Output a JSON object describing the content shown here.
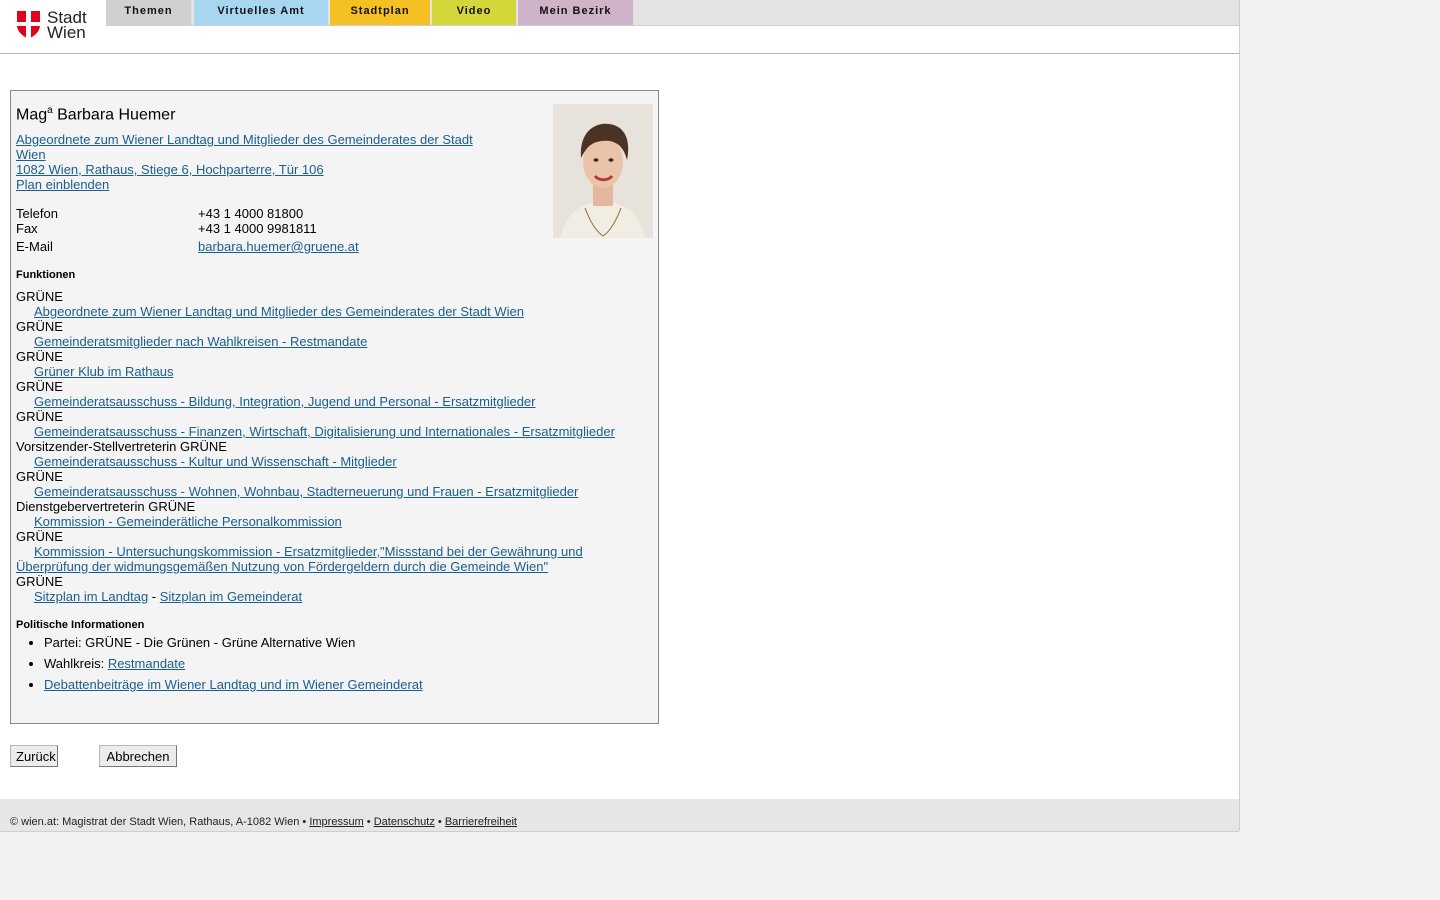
{
  "header": {
    "logo_text_line1": "Stadt",
    "logo_text_line2": "Wien",
    "tabs": [
      {
        "label": "Themen",
        "color": "#d0d0d0"
      },
      {
        "label": "Virtuelles Amt",
        "color": "#a8d5f0"
      },
      {
        "label": "Stadtplan",
        "color": "#f5c022"
      },
      {
        "label": "Video",
        "color": "#d4d73a"
      },
      {
        "label": "Mein Bezirk",
        "color": "#cfb3c8"
      }
    ]
  },
  "person": {
    "title_prefix": "Mag",
    "title_sup": "a",
    "name": " Barbara Huemer",
    "role_link_line1": "Abgeordnete zum Wiener Landtag und Mitglieder des Gemeinderates der Stadt",
    "role_link_line2": "Wien ",
    "address_link": "1082 Wien, Rathaus, Stiege 6, Hochparterre, Tür 106",
    "map_link": "Plan einblenden",
    "phone_label": "Telefon",
    "phone": "+43 1 4000 81800",
    "fax_label": "Fax",
    "fax": "+43 1 4000 9981811",
    "email_label": "E-Mail",
    "email": "barbara.huemer@gruene.at"
  },
  "functions": {
    "title": "Funktionen",
    "items": [
      {
        "org": "GRÜNE",
        "link": "Abgeordnete zum Wiener Landtag und Mitglieder des Gemeinderates der Stadt Wien"
      },
      {
        "org": "GRÜNE",
        "link": "Gemeinderatsmitglieder nach Wahlkreisen - Restmandate"
      },
      {
        "org": "GRÜNE",
        "link": "Grüner Klub im Rathaus"
      },
      {
        "org": "GRÜNE",
        "link": "Gemeinderatsausschuss - Bildung, Integration, Jugend und Personal - Ersatzmitglieder"
      },
      {
        "org": "GRÜNE",
        "link": "Gemeinderatsausschuss - Finanzen, Wirtschaft, Digitalisierung und Internationales - Ersatzmitglieder"
      },
      {
        "org": "Vorsitzender-Stellvertreterin GRÜNE",
        "link": "Gemeinderatsausschuss - Kultur und Wissenschaft - Mitglieder"
      },
      {
        "org": "GRÜNE",
        "link": "Gemeinderatsausschuss - Wohnen, Wohnbau, Stadterneuerung und Frauen - Ersatzmitglieder"
      },
      {
        "org": "Dienstgebervertreterin GRÜNE",
        "link": "Kommission - Gemeinderätliche Personalkommission"
      },
      {
        "org": "GRÜNE",
        "link": "Kommission - Untersuchungskommission - Ersatzmitglieder,\"Missstand bei der Gewährung und Überprüfung der widmungsgemäßen Nutzung von Fördergeldern durch die Gemeinde Wien\""
      }
    ],
    "last_org": "GRÜNE",
    "seat_landtag": "Sitzplan im Landtag",
    "seat_sep": " - ",
    "seat_gemeinderat": "Sitzplan im Gemeinderat"
  },
  "political": {
    "title": "Politische Informationen",
    "party": "Partei: GRÜNE - Die Grünen - Grüne Alternative Wien",
    "district_label": "Wahlkreis: ",
    "district_link": "Restmandate",
    "debates_link": "Debattenbeiträge im Wiener Landtag und im Wiener Gemeinderat"
  },
  "buttons": {
    "back": "Zurück",
    "cancel": "Abbrechen"
  },
  "footer": {
    "copyright": "© wien.at: Magistrat der Stadt Wien, Rathaus, A-1082 Wien • ",
    "impressum": "Impressum",
    "sep": " • ",
    "datenschutz": "Datenschutz",
    "barrierefreiheit": "Barrierefreiheit"
  }
}
